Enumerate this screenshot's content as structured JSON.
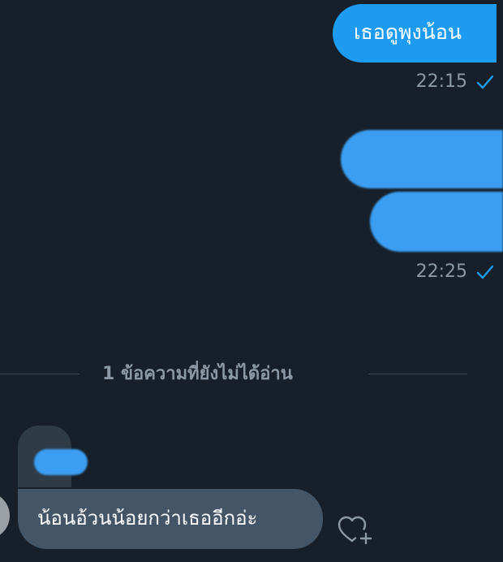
{
  "messages": {
    "outgoing_1": {
      "text": "เธอดูพุงน้อน",
      "time": "22:15"
    },
    "outgoing_2": {
      "time": "22:25"
    },
    "incoming_1": {
      "text": "น้อนอ้วนน้อยกว่าเธออีกอ่ะ"
    }
  },
  "divider": {
    "label": "1 ข้อความที่ยังไม่ได้อ่าน"
  },
  "icons": {
    "read_receipt": "check-icon",
    "reaction": "heart-plus-icon"
  },
  "colors": {
    "background": "#17202a",
    "outgoing_bubble": "#1d9bf0",
    "incoming_bubble": "#435566",
    "meta_text": "#8b98a5",
    "check": "#1d9bf0"
  }
}
